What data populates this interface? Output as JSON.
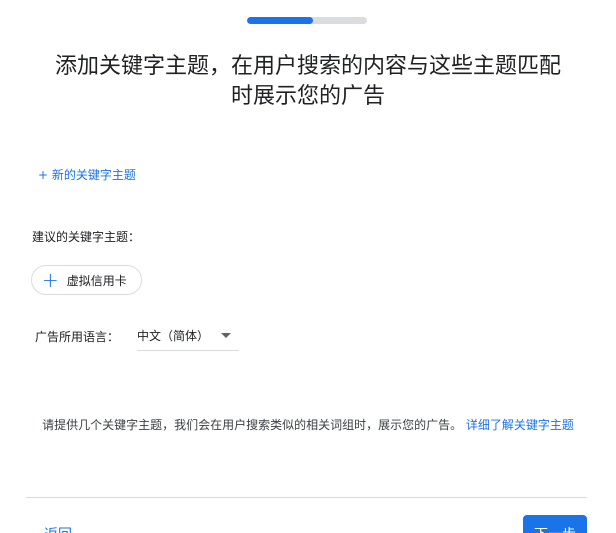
{
  "progress": {
    "fraction": 0.55
  },
  "title": {
    "line1": "添加关键字主题，在用户搜索的内容与这些主题匹配",
    "line2": "时展示您的广告"
  },
  "add_keyword_link": "+ 新的关键字主题",
  "suggested": {
    "label": "建议的关键字主题：",
    "chips": [
      {
        "label": "虚拟信用卡",
        "icon": "plus-icon"
      }
    ]
  },
  "language": {
    "label": "广告所用语言：",
    "selected": "中文（简体）"
  },
  "help": {
    "text": "请提供几个关键字主题，我们会在用户搜索类似的相关词组时，展示您的广告。",
    "link": "详细了解关键字主题"
  },
  "footer": {
    "back_label": "返回",
    "next_label": "下一步"
  },
  "colors": {
    "accent": "#1a73e8",
    "track": "#dadce0"
  }
}
